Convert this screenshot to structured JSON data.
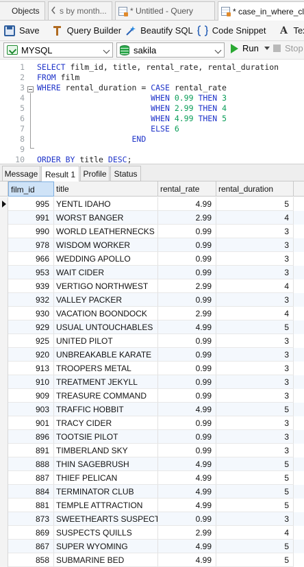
{
  "tabs": [
    {
      "label": "Objects",
      "active": false
    },
    {
      "label": "s by month...",
      "active": false
    },
    {
      "label": "* Untitled - Query",
      "active": false
    },
    {
      "label": "* case_in_where_clau",
      "active": true
    }
  ],
  "toolbar": {
    "save": "Save",
    "query_builder": "Query Builder",
    "beautify": "Beautify SQL",
    "snippet": "Code Snippet",
    "text": "Text"
  },
  "connection": {
    "server": "MYSQL",
    "database": "sakila",
    "run": "Run",
    "stop": "Stop"
  },
  "editor": {
    "lines": [
      {
        "n": "1",
        "text": "SELECT film_id, title, rental_rate, rental_duration"
      },
      {
        "n": "2",
        "text": "FROM film"
      },
      {
        "n": "3",
        "text": "WHERE rental_duration = CASE rental_rate"
      },
      {
        "n": "4",
        "text": "                        WHEN 0.99 THEN 3"
      },
      {
        "n": "5",
        "text": "                        WHEN 2.99 THEN 4"
      },
      {
        "n": "6",
        "text": "                        WHEN 4.99 THEN 5"
      },
      {
        "n": "7",
        "text": "                        ELSE 6"
      },
      {
        "n": "8",
        "text": "                    END"
      },
      {
        "n": "9",
        "text": ""
      },
      {
        "n": "10",
        "text": "ORDER BY title DESC;"
      }
    ]
  },
  "result_tabs": [
    {
      "label": "Message",
      "active": false
    },
    {
      "label": "Result 1",
      "active": true
    },
    {
      "label": "Profile",
      "active": false
    },
    {
      "label": "Status",
      "active": false
    }
  ],
  "grid": {
    "columns": [
      "film_id",
      "title",
      "rental_rate",
      "rental_duration"
    ],
    "rows": [
      [
        "995",
        "YENTL IDAHO",
        "4.99",
        "5"
      ],
      [
        "991",
        "WORST BANGER",
        "2.99",
        "4"
      ],
      [
        "990",
        "WORLD LEATHERNECKS",
        "0.99",
        "3"
      ],
      [
        "978",
        "WISDOM WORKER",
        "0.99",
        "3"
      ],
      [
        "966",
        "WEDDING APOLLO",
        "0.99",
        "3"
      ],
      [
        "953",
        "WAIT CIDER",
        "0.99",
        "3"
      ],
      [
        "939",
        "VERTIGO NORTHWEST",
        "2.99",
        "4"
      ],
      [
        "932",
        "VALLEY PACKER",
        "0.99",
        "3"
      ],
      [
        "930",
        "VACATION BOONDOCK",
        "2.99",
        "4"
      ],
      [
        "929",
        "USUAL UNTOUCHABLES",
        "4.99",
        "5"
      ],
      [
        "925",
        "UNITED PILOT",
        "0.99",
        "3"
      ],
      [
        "920",
        "UNBREAKABLE KARATE",
        "0.99",
        "3"
      ],
      [
        "913",
        "TROOPERS METAL",
        "0.99",
        "3"
      ],
      [
        "910",
        "TREATMENT JEKYLL",
        "0.99",
        "3"
      ],
      [
        "909",
        "TREASURE COMMAND",
        "0.99",
        "3"
      ],
      [
        "903",
        "TRAFFIC HOBBIT",
        "4.99",
        "5"
      ],
      [
        "901",
        "TRACY CIDER",
        "0.99",
        "3"
      ],
      [
        "896",
        "TOOTSIE PILOT",
        "0.99",
        "3"
      ],
      [
        "891",
        "TIMBERLAND SKY",
        "0.99",
        "3"
      ],
      [
        "888",
        "THIN SAGEBRUSH",
        "4.99",
        "5"
      ],
      [
        "887",
        "THIEF PELICAN",
        "4.99",
        "5"
      ],
      [
        "884",
        "TERMINATOR CLUB",
        "4.99",
        "5"
      ],
      [
        "881",
        "TEMPLE ATTRACTION",
        "4.99",
        "5"
      ],
      [
        "873",
        "SWEETHEARTS SUSPECTS",
        "0.99",
        "3"
      ],
      [
        "869",
        "SUSPECTS QUILLS",
        "2.99",
        "4"
      ],
      [
        "867",
        "SUPER WYOMING",
        "4.99",
        "5"
      ],
      [
        "858",
        "SUBMARINE BED",
        "4.99",
        "5"
      ]
    ]
  },
  "colors": {
    "keyword": "#1e33c9",
    "number": "#0a9d58",
    "selected_header": "#cfe3f7",
    "run_icon": "#2aa832"
  }
}
